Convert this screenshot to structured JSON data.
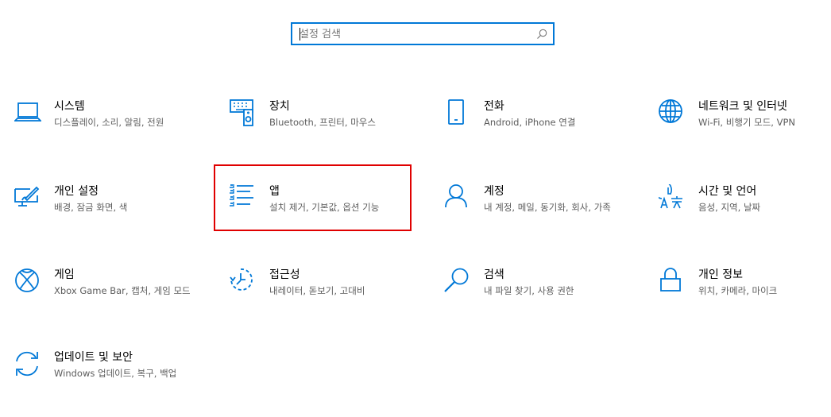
{
  "search": {
    "placeholder": "설정 검색"
  },
  "colors": {
    "accent": "#0078d7",
    "highlight": "#e00000",
    "desc_text": "#5d5d5d"
  },
  "categories": [
    {
      "title": "시스템",
      "desc": "디스플레이, 소리, 알림, 전원",
      "icon": "laptop-icon"
    },
    {
      "title": "장치",
      "desc": "Bluetooth, 프린터, 마우스",
      "icon": "devices-icon"
    },
    {
      "title": "전화",
      "desc": "Android, iPhone 연결",
      "icon": "phone-icon"
    },
    {
      "title": "네트워크 및 인터넷",
      "desc": "Wi-Fi, 비행기 모드, VPN",
      "icon": "globe-icon"
    },
    {
      "title": "개인 설정",
      "desc": "배경, 잠금 화면, 색",
      "icon": "personalization-icon"
    },
    {
      "title": "앱",
      "desc": "설치 제거, 기본값, 옵션 기능",
      "icon": "apps-list-icon"
    },
    {
      "title": "계정",
      "desc": "내 계정, 메일, 동기화, 회사, 가족",
      "icon": "person-icon"
    },
    {
      "title": "시간 및 언어",
      "desc": "음성, 지역, 날짜",
      "icon": "time-language-icon"
    },
    {
      "title": "게임",
      "desc": "Xbox Game Bar, 캡처, 게임 모드",
      "icon": "xbox-icon"
    },
    {
      "title": "접근성",
      "desc": "내레이터, 돋보기, 고대비",
      "icon": "accessibility-icon"
    },
    {
      "title": "검색",
      "desc": "내 파일 찾기, 사용 권한",
      "icon": "search-magnifier-icon"
    },
    {
      "title": "개인 정보",
      "desc": "위치, 카메라, 마이크",
      "icon": "lock-icon"
    },
    {
      "title": "업데이트 및 보안",
      "desc": "Windows 업데이트, 복구, 백업",
      "icon": "update-sync-icon"
    }
  ]
}
